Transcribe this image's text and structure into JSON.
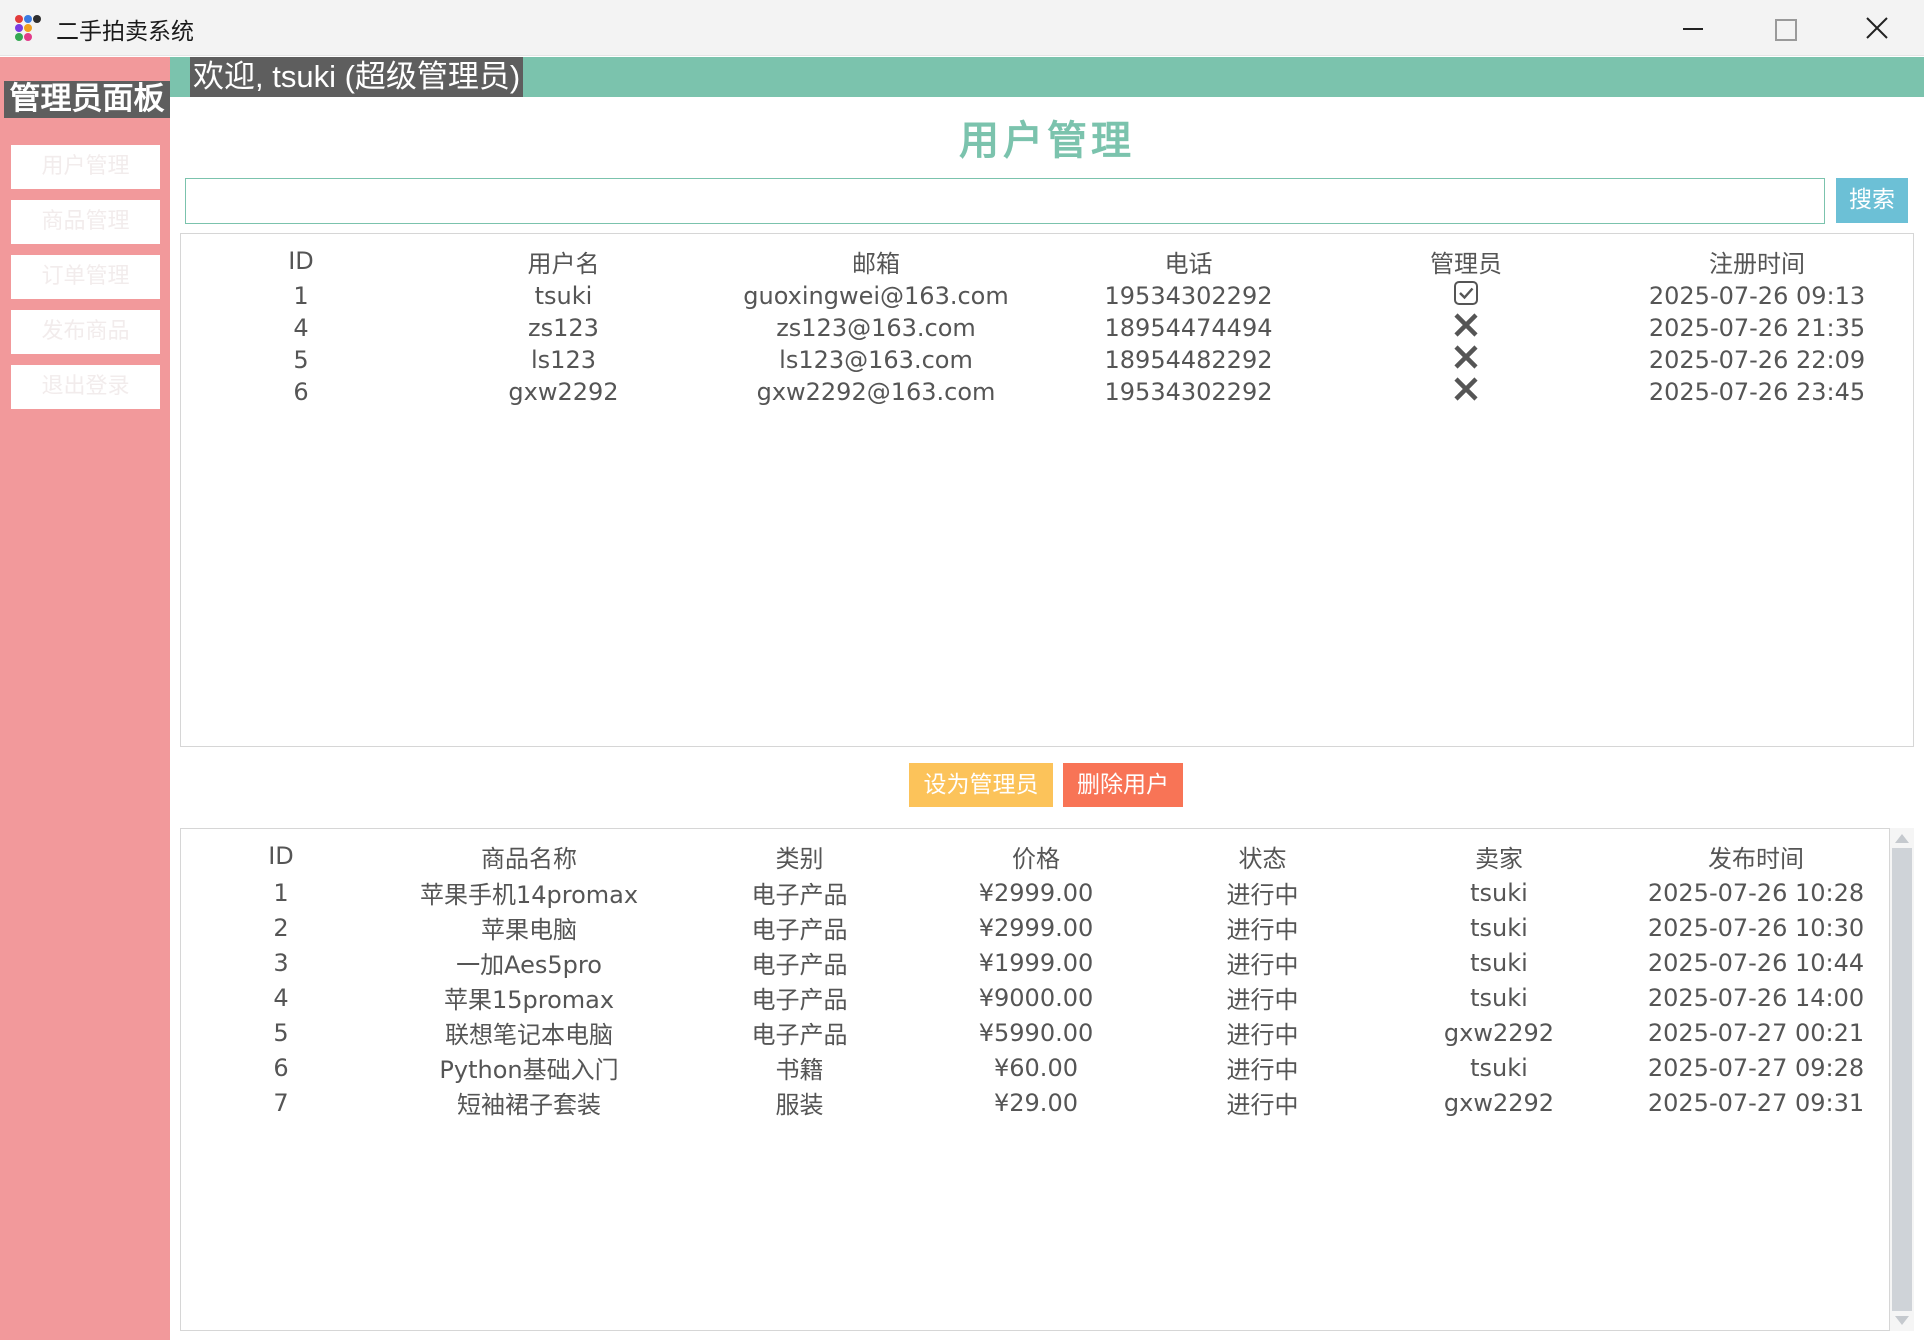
{
  "window": {
    "title": "二手拍卖系统"
  },
  "sidebar": {
    "title": "管理员面板",
    "items": [
      {
        "label": "用户管理"
      },
      {
        "label": "商品管理"
      },
      {
        "label": "订单管理"
      },
      {
        "label": "发布商品"
      },
      {
        "label": "退出登录"
      }
    ]
  },
  "header": {
    "welcome": "欢迎, tsuki (超级管理员)"
  },
  "main": {
    "title": "用户管理",
    "search": {
      "value": "",
      "placeholder": "",
      "button": "搜索"
    },
    "users": {
      "columns": [
        "ID",
        "用户名",
        "邮箱",
        "电话",
        "管理员",
        "注册时间"
      ],
      "rows": [
        {
          "id": "1",
          "username": "tsuki",
          "email": "guoxingwei@163.com",
          "phone": "19534302292",
          "is_admin": true,
          "registered": "2025-07-26 09:13"
        },
        {
          "id": "4",
          "username": "zs123",
          "email": "zs123@163.com",
          "phone": "18954474494",
          "is_admin": false,
          "registered": "2025-07-26 21:35"
        },
        {
          "id": "5",
          "username": "ls123",
          "email": "ls123@163.com",
          "phone": "18954482292",
          "is_admin": false,
          "registered": "2025-07-26 22:09"
        },
        {
          "id": "6",
          "username": "gxw2292",
          "email": "gxw2292@163.com",
          "phone": "19534302292",
          "is_admin": false,
          "registered": "2025-07-26 23:45"
        }
      ]
    },
    "actions": {
      "set_admin": "设为管理员",
      "delete_user": "删除用户"
    },
    "goods": {
      "columns": [
        "ID",
        "商品名称",
        "类别",
        "价格",
        "状态",
        "卖家",
        "发布时间"
      ],
      "rows": [
        {
          "id": "1",
          "name": "苹果手机14promax",
          "category": "电子产品",
          "price": "¥2999.00",
          "status": "进行中",
          "seller": "tsuki",
          "published": "2025-07-26 10:28"
        },
        {
          "id": "2",
          "name": "苹果电脑",
          "category": "电子产品",
          "price": "¥2999.00",
          "status": "进行中",
          "seller": "tsuki",
          "published": "2025-07-26 10:30"
        },
        {
          "id": "3",
          "name": "一加Aes5pro",
          "category": "电子产品",
          "price": "¥1999.00",
          "status": "进行中",
          "seller": "tsuki",
          "published": "2025-07-26 10:44"
        },
        {
          "id": "4",
          "name": "苹果15promax",
          "category": "电子产品",
          "price": "¥9000.00",
          "status": "进行中",
          "seller": "tsuki",
          "published": "2025-07-26 14:00"
        },
        {
          "id": "5",
          "name": "联想笔记本电脑",
          "category": "电子产品",
          "price": "¥5990.00",
          "status": "进行中",
          "seller": "gxw2292",
          "published": "2025-07-27 00:21"
        },
        {
          "id": "6",
          "name": "Python基础入门",
          "category": "书籍",
          "price": "¥60.00",
          "status": "进行中",
          "seller": "tsuki",
          "published": "2025-07-27 09:28"
        },
        {
          "id": "7",
          "name": "短袖裙子套装",
          "category": "服装",
          "price": "¥29.00",
          "status": "进行中",
          "seller": "gxw2292",
          "published": "2025-07-27 09:31"
        }
      ]
    }
  },
  "colors": {
    "sidebar_bg": "#f2999b",
    "accent": "#7bc3ad",
    "label_bg": "#5e5e5e",
    "search_button": "#6cc0d6",
    "set_admin_button": "#fcc35a",
    "delete_button": "#f87456"
  }
}
